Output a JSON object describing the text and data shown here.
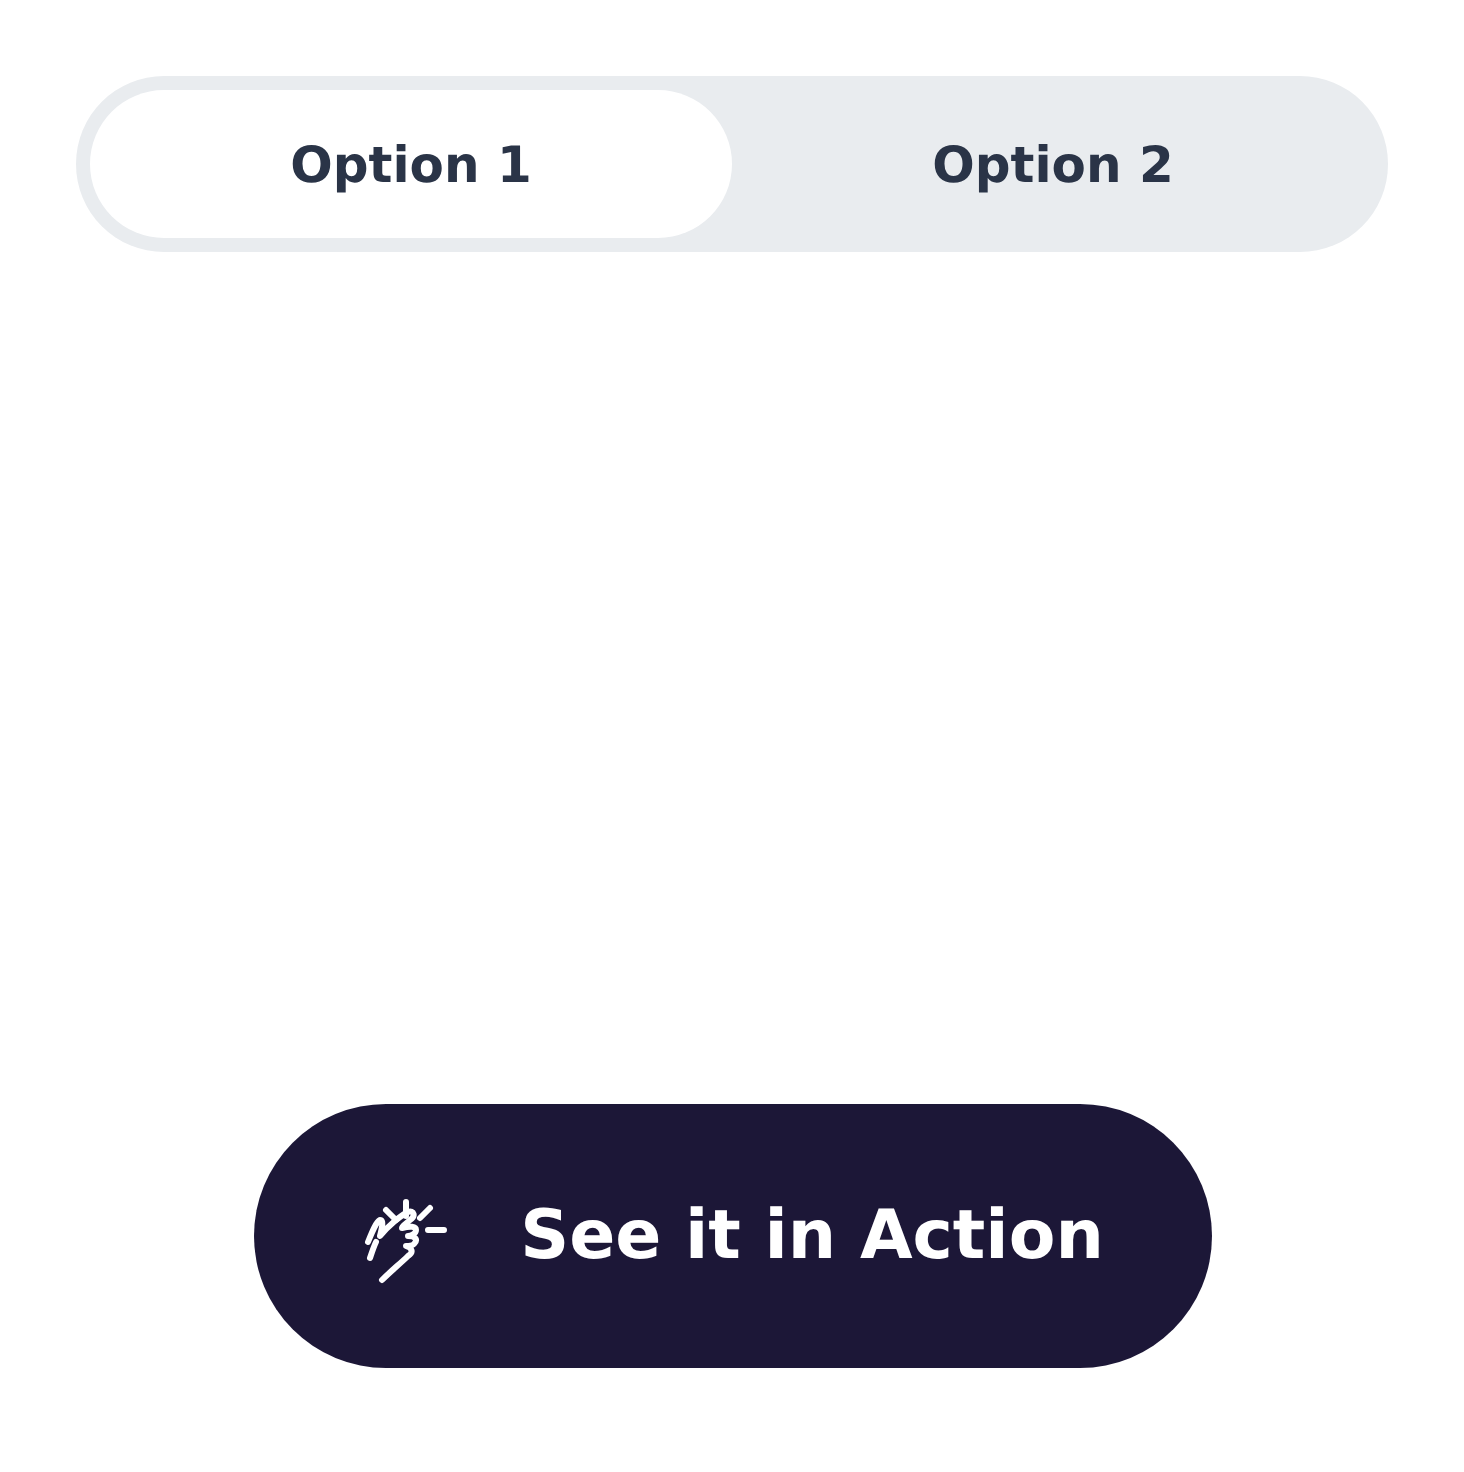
{
  "tabs": [
    {
      "label": "Option 1",
      "selected": true
    },
    {
      "label": "Option 2",
      "selected": false
    }
  ],
  "action_button": {
    "label": "See it in Action"
  }
}
